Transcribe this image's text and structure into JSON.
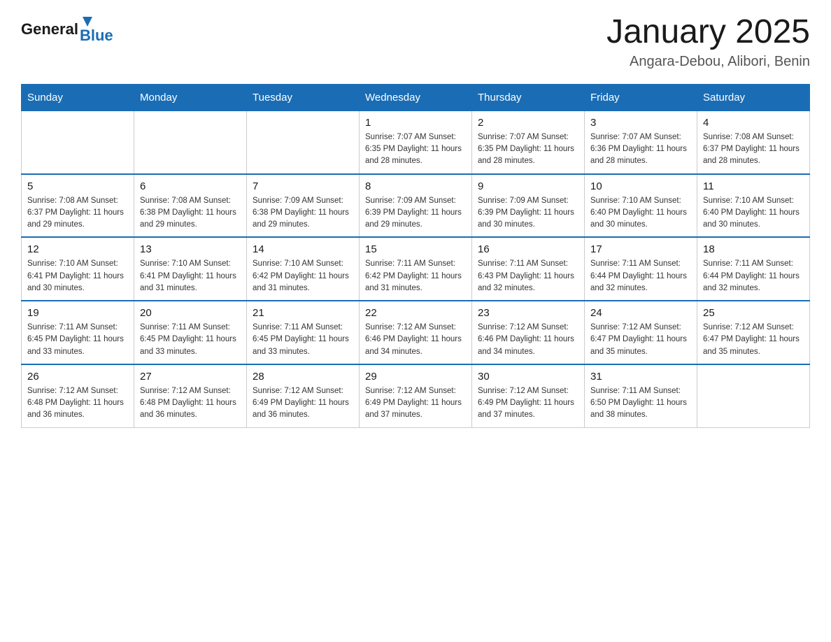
{
  "header": {
    "logo_general": "General",
    "logo_blue": "Blue",
    "title": "January 2025",
    "subtitle": "Angara-Debou, Alibori, Benin"
  },
  "days_header": [
    "Sunday",
    "Monday",
    "Tuesday",
    "Wednesday",
    "Thursday",
    "Friday",
    "Saturday"
  ],
  "weeks": [
    [
      {
        "day": "",
        "info": ""
      },
      {
        "day": "",
        "info": ""
      },
      {
        "day": "",
        "info": ""
      },
      {
        "day": "1",
        "info": "Sunrise: 7:07 AM\nSunset: 6:35 PM\nDaylight: 11 hours\nand 28 minutes."
      },
      {
        "day": "2",
        "info": "Sunrise: 7:07 AM\nSunset: 6:35 PM\nDaylight: 11 hours\nand 28 minutes."
      },
      {
        "day": "3",
        "info": "Sunrise: 7:07 AM\nSunset: 6:36 PM\nDaylight: 11 hours\nand 28 minutes."
      },
      {
        "day": "4",
        "info": "Sunrise: 7:08 AM\nSunset: 6:37 PM\nDaylight: 11 hours\nand 28 minutes."
      }
    ],
    [
      {
        "day": "5",
        "info": "Sunrise: 7:08 AM\nSunset: 6:37 PM\nDaylight: 11 hours\nand 29 minutes."
      },
      {
        "day": "6",
        "info": "Sunrise: 7:08 AM\nSunset: 6:38 PM\nDaylight: 11 hours\nand 29 minutes."
      },
      {
        "day": "7",
        "info": "Sunrise: 7:09 AM\nSunset: 6:38 PM\nDaylight: 11 hours\nand 29 minutes."
      },
      {
        "day": "8",
        "info": "Sunrise: 7:09 AM\nSunset: 6:39 PM\nDaylight: 11 hours\nand 29 minutes."
      },
      {
        "day": "9",
        "info": "Sunrise: 7:09 AM\nSunset: 6:39 PM\nDaylight: 11 hours\nand 30 minutes."
      },
      {
        "day": "10",
        "info": "Sunrise: 7:10 AM\nSunset: 6:40 PM\nDaylight: 11 hours\nand 30 minutes."
      },
      {
        "day": "11",
        "info": "Sunrise: 7:10 AM\nSunset: 6:40 PM\nDaylight: 11 hours\nand 30 minutes."
      }
    ],
    [
      {
        "day": "12",
        "info": "Sunrise: 7:10 AM\nSunset: 6:41 PM\nDaylight: 11 hours\nand 30 minutes."
      },
      {
        "day": "13",
        "info": "Sunrise: 7:10 AM\nSunset: 6:41 PM\nDaylight: 11 hours\nand 31 minutes."
      },
      {
        "day": "14",
        "info": "Sunrise: 7:10 AM\nSunset: 6:42 PM\nDaylight: 11 hours\nand 31 minutes."
      },
      {
        "day": "15",
        "info": "Sunrise: 7:11 AM\nSunset: 6:42 PM\nDaylight: 11 hours\nand 31 minutes."
      },
      {
        "day": "16",
        "info": "Sunrise: 7:11 AM\nSunset: 6:43 PM\nDaylight: 11 hours\nand 32 minutes."
      },
      {
        "day": "17",
        "info": "Sunrise: 7:11 AM\nSunset: 6:44 PM\nDaylight: 11 hours\nand 32 minutes."
      },
      {
        "day": "18",
        "info": "Sunrise: 7:11 AM\nSunset: 6:44 PM\nDaylight: 11 hours\nand 32 minutes."
      }
    ],
    [
      {
        "day": "19",
        "info": "Sunrise: 7:11 AM\nSunset: 6:45 PM\nDaylight: 11 hours\nand 33 minutes."
      },
      {
        "day": "20",
        "info": "Sunrise: 7:11 AM\nSunset: 6:45 PM\nDaylight: 11 hours\nand 33 minutes."
      },
      {
        "day": "21",
        "info": "Sunrise: 7:11 AM\nSunset: 6:45 PM\nDaylight: 11 hours\nand 33 minutes."
      },
      {
        "day": "22",
        "info": "Sunrise: 7:12 AM\nSunset: 6:46 PM\nDaylight: 11 hours\nand 34 minutes."
      },
      {
        "day": "23",
        "info": "Sunrise: 7:12 AM\nSunset: 6:46 PM\nDaylight: 11 hours\nand 34 minutes."
      },
      {
        "day": "24",
        "info": "Sunrise: 7:12 AM\nSunset: 6:47 PM\nDaylight: 11 hours\nand 35 minutes."
      },
      {
        "day": "25",
        "info": "Sunrise: 7:12 AM\nSunset: 6:47 PM\nDaylight: 11 hours\nand 35 minutes."
      }
    ],
    [
      {
        "day": "26",
        "info": "Sunrise: 7:12 AM\nSunset: 6:48 PM\nDaylight: 11 hours\nand 36 minutes."
      },
      {
        "day": "27",
        "info": "Sunrise: 7:12 AM\nSunset: 6:48 PM\nDaylight: 11 hours\nand 36 minutes."
      },
      {
        "day": "28",
        "info": "Sunrise: 7:12 AM\nSunset: 6:49 PM\nDaylight: 11 hours\nand 36 minutes."
      },
      {
        "day": "29",
        "info": "Sunrise: 7:12 AM\nSunset: 6:49 PM\nDaylight: 11 hours\nand 37 minutes."
      },
      {
        "day": "30",
        "info": "Sunrise: 7:12 AM\nSunset: 6:49 PM\nDaylight: 11 hours\nand 37 minutes."
      },
      {
        "day": "31",
        "info": "Sunrise: 7:11 AM\nSunset: 6:50 PM\nDaylight: 11 hours\nand 38 minutes."
      },
      {
        "day": "",
        "info": ""
      }
    ]
  ]
}
